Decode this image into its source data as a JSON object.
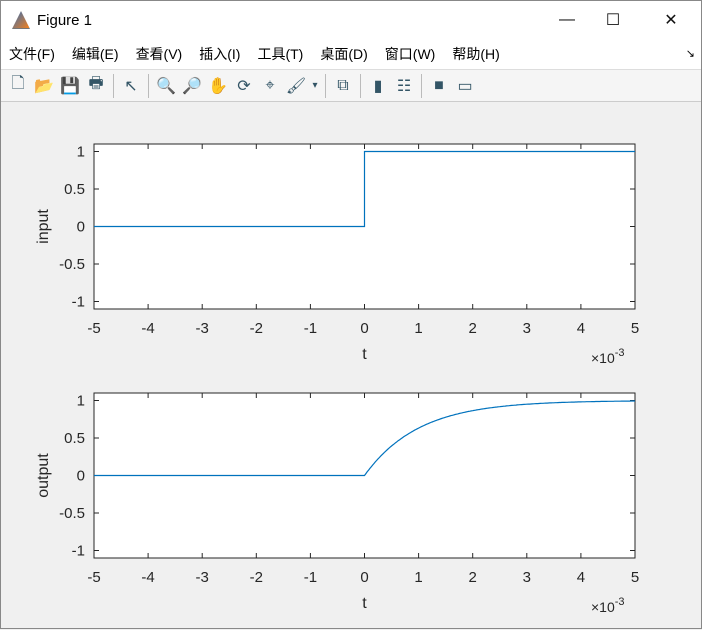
{
  "window": {
    "title": "Figure 1",
    "minimize": "—",
    "maximize": "☐",
    "close": "✕"
  },
  "menu": [
    "文件(F)",
    "编辑(E)",
    "查看(V)",
    "插入(I)",
    "工具(T)",
    "桌面(D)",
    "窗口(W)",
    "帮助(H)"
  ],
  "dock_icon": "↘",
  "toolbar": [
    {
      "name": "new-figure-icon",
      "glyph": "🗋"
    },
    {
      "name": "open-file-icon",
      "glyph": "📂"
    },
    {
      "name": "save-icon",
      "glyph": "💾"
    },
    {
      "name": "print-icon",
      "glyph": "🖶"
    },
    {
      "sep": true
    },
    {
      "name": "pointer-icon",
      "glyph": "↖"
    },
    {
      "sep": true
    },
    {
      "name": "zoom-in-icon",
      "glyph": "🔍"
    },
    {
      "name": "zoom-out-icon",
      "glyph": "🔎"
    },
    {
      "name": "pan-icon",
      "glyph": "✋"
    },
    {
      "name": "rotate-3d-icon",
      "glyph": "⟳"
    },
    {
      "name": "data-cursor-icon",
      "glyph": "⌖"
    },
    {
      "name": "brush-icon",
      "glyph": "🖌"
    },
    {
      "name": "brush-dropdown-icon",
      "glyph": "▾"
    },
    {
      "sep": true
    },
    {
      "name": "link-plot-icon",
      "glyph": "⧉"
    },
    {
      "sep": true
    },
    {
      "name": "colorbar-icon",
      "glyph": "▮"
    },
    {
      "name": "legend-icon",
      "glyph": "☷"
    },
    {
      "sep": true
    },
    {
      "name": "hide-plot-tools-icon",
      "glyph": "■"
    },
    {
      "name": "show-plot-tools-icon",
      "glyph": "▭"
    }
  ],
  "colors": {
    "line": "#0072bd",
    "axis": "#262626"
  },
  "chart_data": [
    {
      "type": "line",
      "ylabel": "input",
      "xlabel": "t",
      "x_exponent": "×10^-3",
      "xlim": [
        -0.005,
        0.005
      ],
      "ylim": [
        -1.1,
        1.1
      ],
      "xticks": [
        "-5",
        "-4",
        "-3",
        "-2",
        "-1",
        "0",
        "1",
        "2",
        "3",
        "4",
        "5"
      ],
      "yticks": [
        "1",
        "0.5",
        "0",
        "-0.5",
        "-1"
      ],
      "series": [
        {
          "name": "input",
          "function": "step",
          "points": [
            [
              -0.005,
              0
            ],
            [
              0,
              0
            ],
            [
              0,
              1
            ],
            [
              0.005,
              1
            ]
          ]
        }
      ]
    },
    {
      "type": "line",
      "ylabel": "output",
      "xlabel": "t",
      "x_exponent": "×10^-3",
      "xlim": [
        -0.005,
        0.005
      ],
      "ylim": [
        -1.1,
        1.1
      ],
      "xticks": [
        "-5",
        "-4",
        "-3",
        "-2",
        "-1",
        "0",
        "1",
        "2",
        "3",
        "4",
        "5"
      ],
      "yticks": [
        "1",
        "0.5",
        "0",
        "-0.5",
        "-1"
      ],
      "series": [
        {
          "name": "output",
          "function": "1-exp(-t/0.001) for t>=0, else 0",
          "time_constant": 0.001
        }
      ]
    }
  ]
}
